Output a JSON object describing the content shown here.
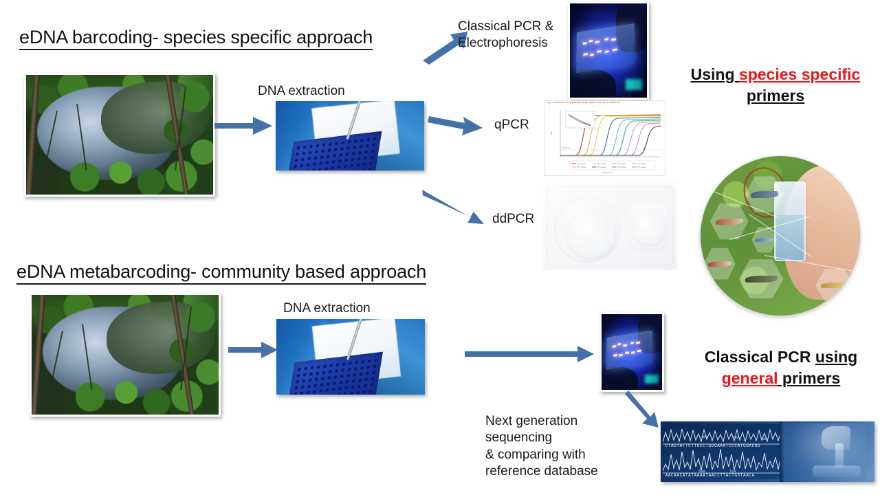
{
  "slide": {
    "title_species": "eDNA barcoding- species specific approach",
    "title_community": "eDNA metabarcoding- community based approach",
    "background_color": "#ffffff",
    "arrow_color": "#4472a8"
  },
  "top_workflow": {
    "extraction_label": "DNA extraction",
    "branches": [
      {
        "id": "pcr",
        "label": "Classical PCR &\nElectrophoresis"
      },
      {
        "id": "qpcr",
        "label": "qPCR"
      },
      {
        "id": "ddpcr",
        "label": "ddPCR"
      }
    ]
  },
  "bottom_workflow": {
    "extraction_label": "DNA extraction",
    "ngs_label": "Next generation\nsequencing\n& comparing with\nreference database"
  },
  "callouts": {
    "species_specific": {
      "line1_part1": "Using ",
      "line1_part2": "species specific",
      "line2": "primers",
      "highlight_color": "#e8161a"
    },
    "general": {
      "line1_part1": "Classical PCR ",
      "line1_part2": "using",
      "line2_part1": "general",
      "line2_part2": " primers",
      "highlight_color": "#e8161a"
    }
  },
  "images": {
    "stream_top": {
      "name": "stream-habitat-photo",
      "alt": "Woodland stream water body"
    },
    "lab_top": {
      "name": "dna-extraction-photo",
      "alt": "Gloved hands loading a blue PCR plate"
    },
    "gel_top": {
      "name": "gel-electrophoresis-photo",
      "alt": "Agarose gel on UV transilluminator"
    },
    "qpcr_chart": {
      "name": "qpcr-amplification-chart",
      "alt": "Real-time PCR amplification curves"
    },
    "ddpcr_device": {
      "name": "ddpcr-instrument-photo",
      "alt": "Droplet digital PCR instrument"
    },
    "edna_concept": {
      "name": "edna-concept-circle-image",
      "alt": "Hand holding water sample vial with fish hexagons"
    },
    "stream_bottom": {
      "name": "stream-habitat-photo-2",
      "alt": "Woodland stream water body"
    },
    "lab_bottom": {
      "name": "dna-extraction-photo-2",
      "alt": "Gloved hands loading a blue PCR plate"
    },
    "gel_bottom": {
      "name": "gel-electrophoresis-photo-2",
      "alt": "Agarose gel on UV transilluminator"
    },
    "sequencing": {
      "name": "sequencing-chromatogram-photo",
      "alt": "DNA chromatogram trace beside a microscope"
    }
  },
  "qpcr_chart_caption": "Fig. 1. Real-time PCR Amplification using TaqMan Probe qPCR Master Mix",
  "sequencing_reads": {
    "line1": "CTAGTATTCTTGCCTGGGAAATCCCATGGACAG",
    "line2": "AACAACATATAAAATAACCTTACTGGTAACA",
    "ticks": [
      "450",
      "420",
      "460",
      "500",
      "510"
    ]
  },
  "chart_data": {
    "type": "line",
    "title": "Real-time PCR amplification curves",
    "xlabel": "Cycle Number",
    "ylabel": "RFU",
    "xlim": [
      0,
      40
    ],
    "ylim": [
      0,
      1
    ],
    "threshold": 0.12,
    "grid": false,
    "legend_position": "bottom",
    "series": [
      {
        "name": "10^8 copies",
        "color": "#c0392b",
        "ct": 8
      },
      {
        "name": "10^7 copies",
        "color": "#e8b24a",
        "ct": 11
      },
      {
        "name": "10^6 copies",
        "color": "#e8e04a",
        "ct": 13.5
      },
      {
        "name": "10^5 copies",
        "color": "#4a5ea8",
        "ct": 17
      },
      {
        "name": "10^4 copies",
        "color": "#5fc3c8",
        "ct": 20
      },
      {
        "name": "10^3 copies",
        "color": "#4aa870",
        "ct": 23
      },
      {
        "name": "10^2 copies",
        "color": "#a8a0d8",
        "ct": 26
      },
      {
        "name": "10^1 copies",
        "color": "#d88ab0",
        "ct": 29
      },
      {
        "name": "NTC",
        "color": "#333333",
        "ct": 33
      }
    ]
  }
}
